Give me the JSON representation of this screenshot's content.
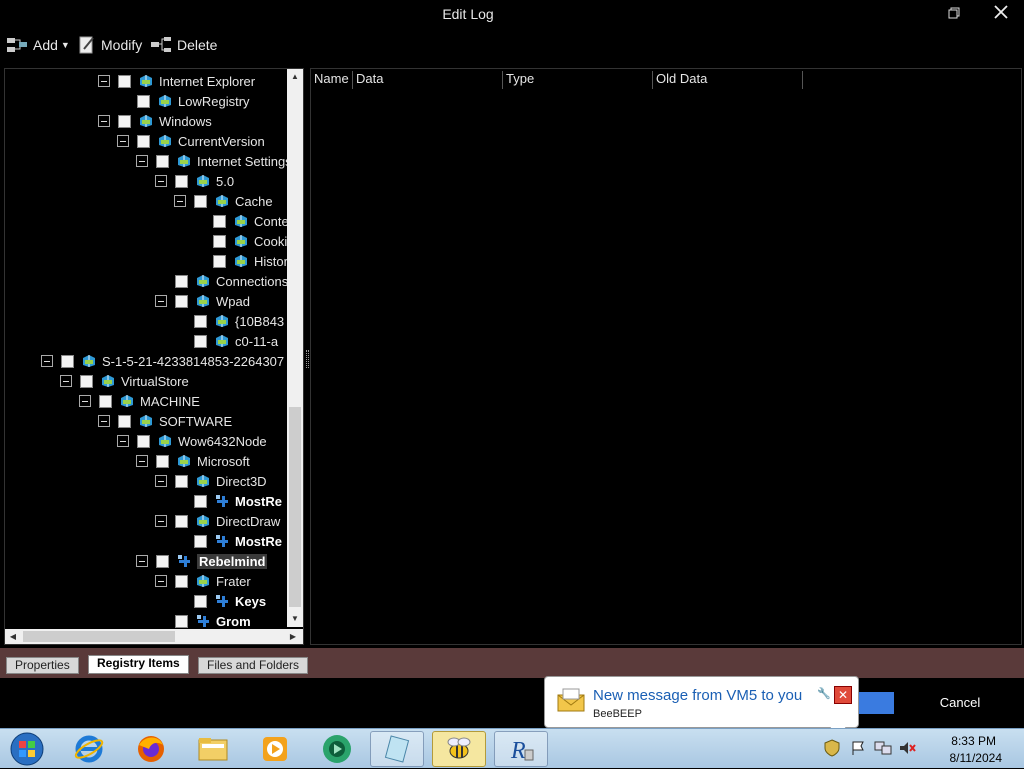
{
  "window": {
    "title": "Edit Log"
  },
  "toolbar": {
    "add_label": "Add",
    "modify_label": "Modify",
    "delete_label": "Delete"
  },
  "tree": {
    "items": [
      {
        "label": "Internet Explorer",
        "indent": 5,
        "expander": true,
        "bold": false,
        "selected": false,
        "icon": "registry-key-icon"
      },
      {
        "label": "LowRegistry",
        "indent": 6,
        "expander": false,
        "bold": false,
        "selected": false,
        "icon": "registry-key-icon"
      },
      {
        "label": "Windows",
        "indent": 5,
        "expander": true,
        "bold": false,
        "selected": false,
        "icon": "registry-key-icon"
      },
      {
        "label": "CurrentVersion",
        "indent": 6,
        "expander": true,
        "bold": false,
        "selected": false,
        "icon": "registry-key-icon"
      },
      {
        "label": "Internet Settings",
        "indent": 7,
        "expander": true,
        "bold": false,
        "selected": false,
        "icon": "registry-key-icon"
      },
      {
        "label": "5.0",
        "indent": 8,
        "expander": true,
        "bold": false,
        "selected": false,
        "icon": "registry-key-icon"
      },
      {
        "label": "Cache",
        "indent": 9,
        "expander": true,
        "bold": false,
        "selected": false,
        "icon": "registry-key-icon"
      },
      {
        "label": "Content",
        "indent": 10,
        "expander": false,
        "bold": false,
        "selected": false,
        "icon": "registry-key-icon"
      },
      {
        "label": "Cookies",
        "indent": 10,
        "expander": false,
        "bold": false,
        "selected": false,
        "icon": "registry-key-icon"
      },
      {
        "label": "History",
        "indent": 10,
        "expander": false,
        "bold": false,
        "selected": false,
        "icon": "registry-key-icon"
      },
      {
        "label": "Connections",
        "indent": 8,
        "expander": false,
        "bold": false,
        "selected": false,
        "icon": "registry-key-icon"
      },
      {
        "label": "Wpad",
        "indent": 8,
        "expander": true,
        "bold": false,
        "selected": false,
        "icon": "registry-key-icon"
      },
      {
        "label": "{10B843",
        "indent": 9,
        "expander": false,
        "bold": false,
        "selected": false,
        "icon": "registry-key-icon"
      },
      {
        "label": "c0-11-a",
        "indent": 9,
        "expander": false,
        "bold": false,
        "selected": false,
        "icon": "registry-key-icon"
      },
      {
        "label": "S-1-5-21-4233814853-2264307",
        "indent": 2,
        "expander": true,
        "bold": false,
        "selected": false,
        "icon": "registry-key-icon"
      },
      {
        "label": "VirtualStore",
        "indent": 3,
        "expander": true,
        "bold": false,
        "selected": false,
        "icon": "registry-key-icon"
      },
      {
        "label": "MACHINE",
        "indent": 4,
        "expander": true,
        "bold": false,
        "selected": false,
        "icon": "registry-key-icon"
      },
      {
        "label": "SOFTWARE",
        "indent": 5,
        "expander": true,
        "bold": false,
        "selected": false,
        "icon": "registry-key-icon"
      },
      {
        "label": "Wow6432Node",
        "indent": 6,
        "expander": true,
        "bold": false,
        "selected": false,
        "icon": "registry-key-icon"
      },
      {
        "label": "Microsoft",
        "indent": 7,
        "expander": true,
        "bold": false,
        "selected": false,
        "icon": "registry-key-icon"
      },
      {
        "label": "Direct3D",
        "indent": 8,
        "expander": true,
        "bold": false,
        "selected": false,
        "icon": "registry-key-icon"
      },
      {
        "label": "MostRe",
        "indent": 9,
        "expander": false,
        "bold": true,
        "selected": false,
        "icon": "registry-value-icon"
      },
      {
        "label": "DirectDraw",
        "indent": 8,
        "expander": true,
        "bold": false,
        "selected": false,
        "icon": "registry-key-icon"
      },
      {
        "label": "MostRe",
        "indent": 9,
        "expander": false,
        "bold": true,
        "selected": false,
        "icon": "registry-value-icon"
      },
      {
        "label": "Rebelmind",
        "indent": 7,
        "expander": true,
        "bold": true,
        "selected": true,
        "icon": "registry-value-icon"
      },
      {
        "label": "Frater",
        "indent": 8,
        "expander": true,
        "bold": false,
        "selected": false,
        "icon": "registry-key-icon"
      },
      {
        "label": "Keys",
        "indent": 9,
        "expander": false,
        "bold": true,
        "selected": false,
        "icon": "registry-value-icon"
      },
      {
        "label": "Grom",
        "indent": 8,
        "expander": false,
        "bold": true,
        "selected": false,
        "icon": "registry-value-icon"
      }
    ]
  },
  "list": {
    "columns": [
      "Name",
      "Data",
      "Type",
      "Old Data"
    ]
  },
  "tabs": [
    {
      "label": "Properties",
      "active": false
    },
    {
      "label": "Registry Items",
      "active": true
    },
    {
      "label": "Files and Folders",
      "active": false
    }
  ],
  "buttons": {
    "cancel_label": "Cancel"
  },
  "notification": {
    "title": "New message from VM5 to you",
    "subtitle": "BeeBEEP",
    "close_glyph": "✕"
  },
  "taskbar": {
    "items": [
      {
        "name": "start-button",
        "icon": "windows-orb-icon"
      },
      {
        "name": "internet-explorer",
        "icon": "ie-icon"
      },
      {
        "name": "firefox",
        "icon": "firefox-icon"
      },
      {
        "name": "file-explorer",
        "icon": "folder-icon"
      },
      {
        "name": "media-player",
        "icon": "media-icon"
      },
      {
        "name": "app-green",
        "icon": "green-app-icon"
      },
      {
        "name": "notepad-app",
        "icon": "notepad-icon"
      },
      {
        "name": "beebeep",
        "icon": "bee-icon"
      },
      {
        "name": "regshot-app",
        "icon": "r-app-icon"
      }
    ],
    "clock_time": "8:33 PM",
    "clock_date": "8/11/2024"
  },
  "colors": {
    "tab_bar_bg": "#5a3a3a",
    "notify_title": "#1a5fb4",
    "taskbar_bg": "#b8d4ea"
  }
}
